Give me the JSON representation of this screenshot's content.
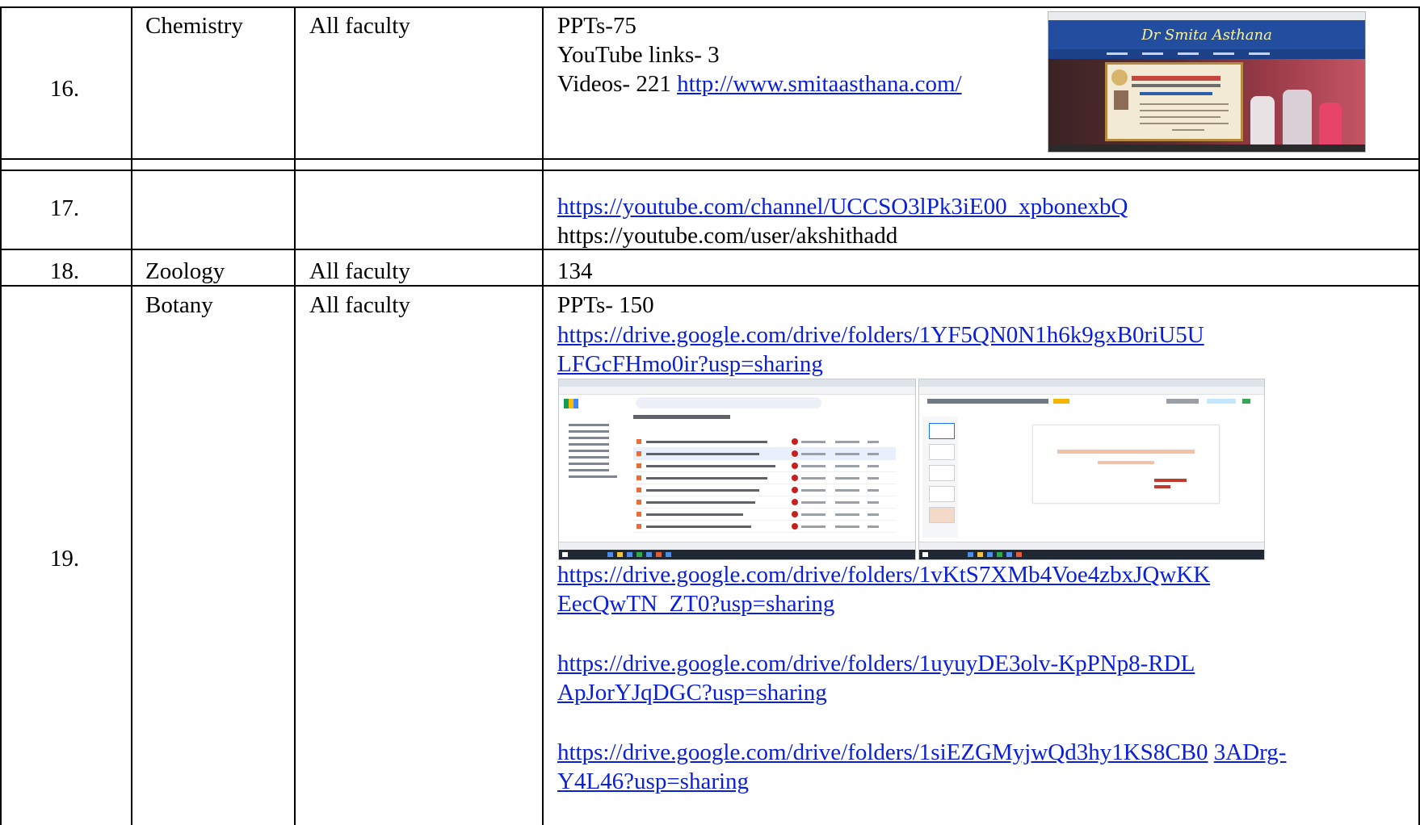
{
  "rows": [
    {
      "number": "16.",
      "subject": "Chemistry",
      "faculty": "All faculty",
      "resources": {
        "line1": "PPTs-75",
        "line2": "YouTube links- 3",
        "line3_prefix": "Videos- 221 ",
        "line3_link": "http://www.smitaasthana.com/"
      },
      "image": {
        "icon": "website-screenshot",
        "banner_text": "Dr Smita Asthana"
      }
    },
    {
      "number": "17.",
      "subject": "",
      "faculty": "",
      "resources": {
        "link1": "https://youtube.com/channel/UCCSO3lPk3iE00_xpbonexbQ",
        "line2": "https://youtube.com/user/akshithadd"
      }
    },
    {
      "number": "18.",
      "subject": "Zoology",
      "faculty": "All faculty",
      "resources": {
        "line1": "134"
      }
    },
    {
      "number": "19.",
      "subject": "Botany",
      "faculty": "All faculty",
      "resources": {
        "line1": "PPTs- 150",
        "link1_a": "https://drive.google.com/drive/folders/1YF5QN0N1h6k9gxB0riU5U",
        "link1_b": "LFGcFHmo0ir?usp=sharing",
        "link2_a": "https://drive.google.com/drive/folders/1vKtS7XMb4Voe4zbxJQwKK",
        "link2_b": "EecQwTN_ZT0?usp=sharing",
        "link3_a": "https://drive.google.com/drive/folders/1uyuyDE3olv-KpPNp8-RDL",
        "link3_b": "ApJorYJqDGC?usp=sharing",
        "link4_a1": "https://drive.google.com/drive/folders/1siEZGMyjwQd3hy1KS8CB0",
        "link4_a2": "3ADrg-",
        "link4_b": "Y4L46?usp=sharing"
      },
      "images": [
        {
          "icon": "google-drive-screenshot"
        },
        {
          "icon": "powerpoint-viewer-screenshot"
        }
      ]
    }
  ],
  "colors": {
    "link": "#0b20d6",
    "border": "#000000"
  }
}
